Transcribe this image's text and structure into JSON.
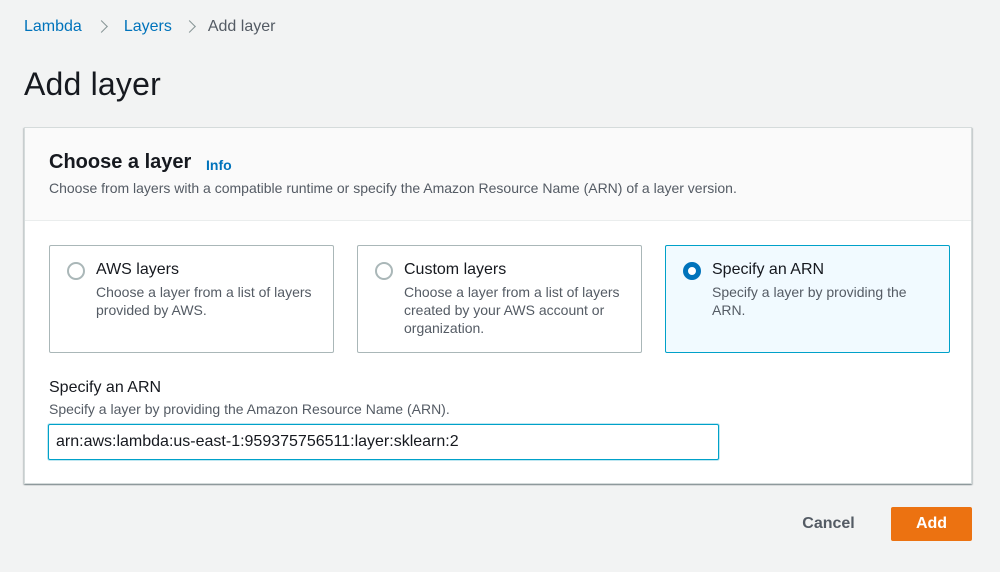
{
  "breadcrumb": {
    "items": [
      {
        "label": "Lambda"
      },
      {
        "label": "Layers"
      },
      {
        "label": "Add layer"
      }
    ]
  },
  "page": {
    "title": "Add layer"
  },
  "panel": {
    "title": "Choose a layer",
    "info_label": "Info",
    "description": "Choose from layers with a compatible runtime or specify the Amazon Resource Name (ARN) of a layer version."
  },
  "tiles": [
    {
      "title": "AWS layers",
      "description": "Choose a layer from a list of layers provided by AWS.",
      "selected": false
    },
    {
      "title": "Custom layers",
      "description": "Choose a layer from a list of layers created by your AWS account or organization.",
      "selected": false
    },
    {
      "title": "Specify an ARN",
      "description": "Specify a layer by providing the ARN.",
      "selected": true
    }
  ],
  "arn_field": {
    "label": "Specify an ARN",
    "description": "Specify a layer by providing the Amazon Resource Name (ARN).",
    "value": "arn:aws:lambda:us-east-1:959375756511:layer:sklearn:2"
  },
  "actions": {
    "cancel_label": "Cancel",
    "add_label": "Add"
  },
  "colors": {
    "accent": "#0073bb",
    "primary_button": "#ec7211",
    "selected_tile_bg": "#f1faff",
    "selected_tile_border": "#00a1c9"
  }
}
